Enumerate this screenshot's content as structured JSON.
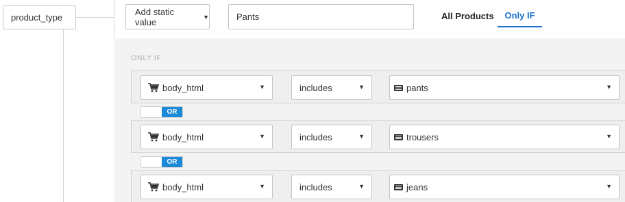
{
  "field": {
    "name": "product_type"
  },
  "top": {
    "mode_select": "Add static value",
    "value": "Pants"
  },
  "tabs": [
    {
      "label": "All Products",
      "active": false
    },
    {
      "label": "Only IF",
      "active": true
    }
  ],
  "panel": {
    "label": "ONLY IF"
  },
  "conditions": [
    {
      "field": "body_html",
      "operator": "includes",
      "value": "pants"
    },
    {
      "field": "body_html",
      "operator": "includes",
      "value": "trousers"
    },
    {
      "field": "body_html",
      "operator": "includes",
      "value": "jeans"
    }
  ],
  "joiners": [
    {
      "label": "OR"
    },
    {
      "label": "OR"
    }
  ],
  "colors": {
    "accent": "#1a73c8",
    "toggle_on": "#1a8ad8",
    "panel_bg": "#f3f3f3"
  },
  "icons": {
    "field_icon": "shopping-cart-icon",
    "value_icon": "keyboard-icon",
    "caret": "caret-down-icon"
  }
}
